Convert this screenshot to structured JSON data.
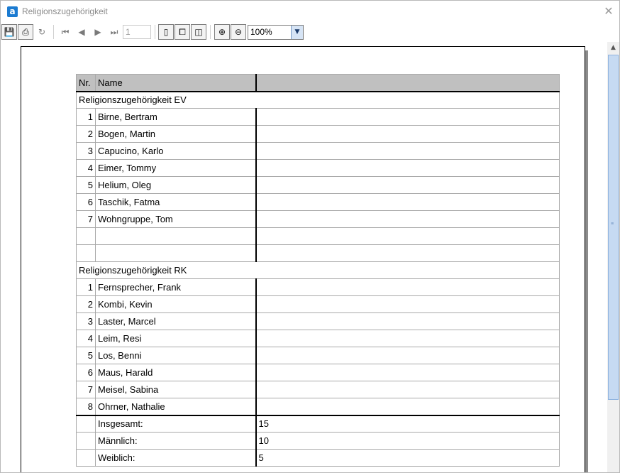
{
  "window": {
    "title": "Religionszugehörigkeit",
    "app_icon_letter": "a",
    "close_glyph": "✕"
  },
  "toolbar": {
    "page_number": "1",
    "zoom": "100%",
    "icons": {
      "save": "💾",
      "print": "⎙",
      "refresh": "↻",
      "first": "⏮",
      "prev": "◀",
      "next": "▶",
      "last": "⏭",
      "one_page": "▯",
      "page_width": "⧠",
      "whole_page": "◫",
      "zoom_in": "⊕",
      "zoom_out": "⊖",
      "dropdown": "▼"
    }
  },
  "scrollbar": {
    "up_glyph": "▲",
    "grip_glyph": "≡"
  },
  "report": {
    "headers": {
      "nr": "Nr.",
      "name": "Name",
      "extra": ""
    },
    "groups": [
      {
        "title": "Religionszugehörigkeit EV",
        "rows": [
          {
            "nr": "1",
            "name": "Birne, Bertram"
          },
          {
            "nr": "2",
            "name": "Bogen, Martin"
          },
          {
            "nr": "3",
            "name": "Capucino, Karlo"
          },
          {
            "nr": "4",
            "name": "Eimer, Tommy"
          },
          {
            "nr": "5",
            "name": "Helium, Oleg"
          },
          {
            "nr": "6",
            "name": "Taschik, Fatma"
          },
          {
            "nr": "7",
            "name": "Wohngruppe, Tom"
          },
          {
            "nr": "",
            "name": ""
          },
          {
            "nr": "",
            "name": ""
          }
        ]
      },
      {
        "title": "Religionszugehörigkeit RK",
        "rows": [
          {
            "nr": "1",
            "name": "Fernsprecher, Frank"
          },
          {
            "nr": "2",
            "name": "Kombi, Kevin"
          },
          {
            "nr": "3",
            "name": "Laster, Marcel"
          },
          {
            "nr": "4",
            "name": "Leim, Resi"
          },
          {
            "nr": "5",
            "name": "Los, Benni"
          },
          {
            "nr": "6",
            "name": "Maus, Harald"
          },
          {
            "nr": "7",
            "name": "Meisel, Sabina"
          },
          {
            "nr": "8",
            "name": "Ohrner, Nathalie"
          }
        ]
      }
    ],
    "summary": [
      {
        "label": "Insgesamt:",
        "value": "15"
      },
      {
        "label": "Männlich:",
        "value": "10"
      },
      {
        "label": "Weiblich:",
        "value": "5"
      }
    ]
  }
}
